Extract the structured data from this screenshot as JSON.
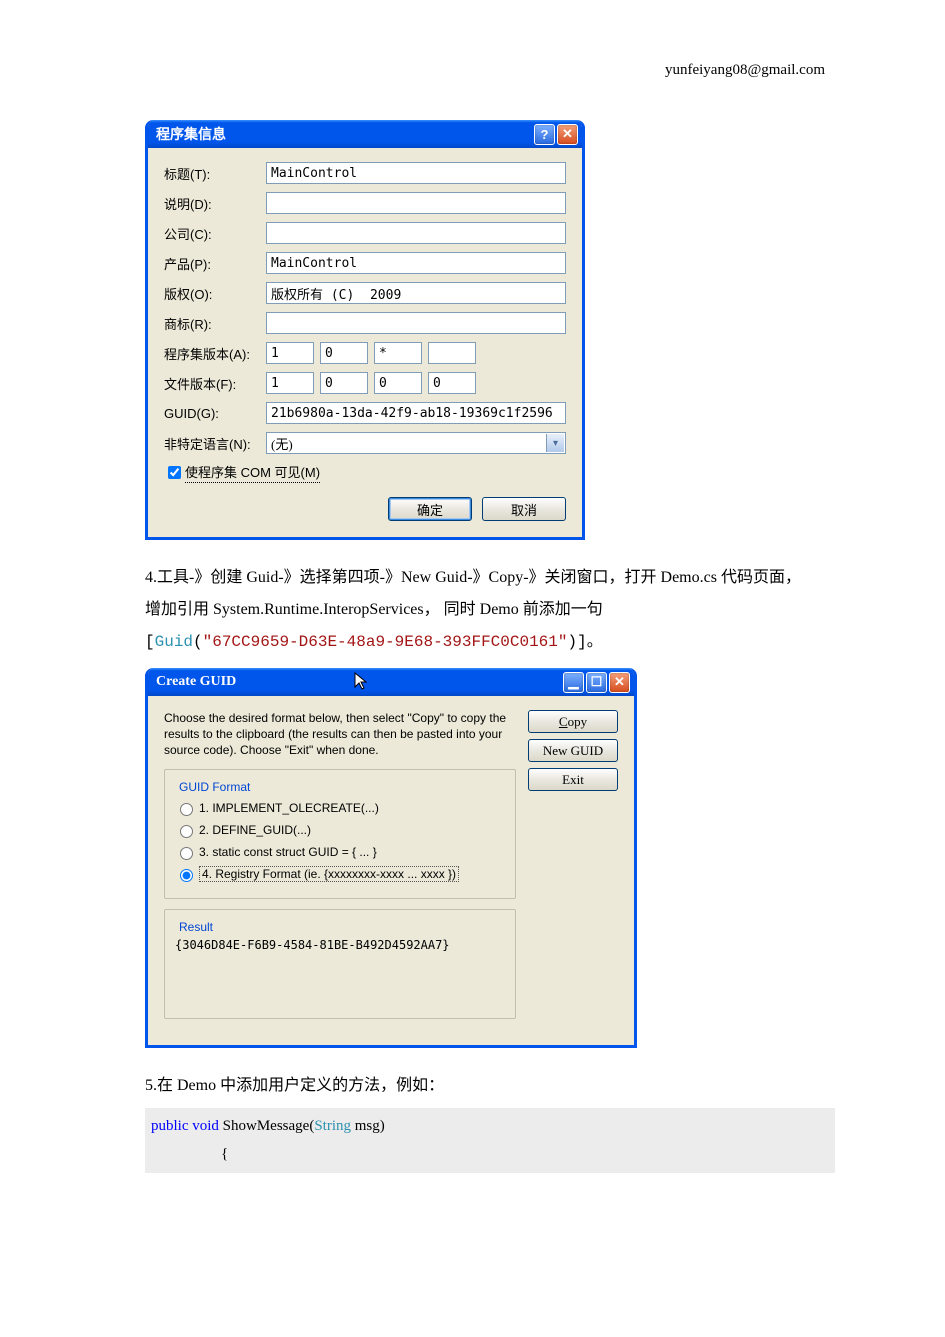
{
  "header": {
    "email": "yunfeiyang08@gmail.com"
  },
  "asm_dialog": {
    "title": "程序集信息",
    "labels": {
      "title": "标题(T):",
      "desc": "说明(D):",
      "company": "公司(C):",
      "product": "产品(P):",
      "copyright": "版权(O):",
      "trademark": "商标(R):",
      "asm_ver": "程序集版本(A):",
      "file_ver": "文件版本(F):",
      "guid": "GUID(G):",
      "lang": "非特定语言(N):"
    },
    "values": {
      "title": "MainControl",
      "desc": "",
      "company": "",
      "product": "MainControl",
      "copyright": "版权所有 (C)  2009",
      "trademark": "",
      "asm_ver": [
        "1",
        "0",
        "*",
        ""
      ],
      "file_ver": [
        "1",
        "0",
        "0",
        "0"
      ],
      "guid": "21b6980a-13da-42f9-ab18-19369c1f2596",
      "lang": "(无)"
    },
    "chk_label": "使程序集 COM 可见(M)",
    "ok": "确定",
    "cancel": "取消"
  },
  "para4_a": "4.工具-》创建 Guid-》选择第四项-》New Guid-》Copy-》关闭窗口，打开 Demo.cs 代码页面，",
  "para4_b": "增加引用 System.Runtime.InteropServices， 同时 Demo 前添加一句",
  "guid_attr": {
    "open": "[",
    "type": "Guid",
    "paren_open": "(",
    "str": "\"67CC9659-D63E-48a9-9E68-393FFC0C0161\"",
    "paren_close": ")]",
    "tail": "。"
  },
  "guid_dialog": {
    "title": "Create GUID",
    "instr": "Choose the desired format below, then select \"Copy\" to copy the results to the clipboard (the results can then be pasted into your source code).  Choose \"Exit\" when done.",
    "legend_format": "GUID Format",
    "opts": {
      "o1": "1. IMPLEMENT_OLECREATE(...)",
      "o2": "2. DEFINE_GUID(...)",
      "o3": "3. static const struct GUID = { ... }",
      "o4": "4. Registry Format (ie. {xxxxxxxx-xxxx ... xxxx })"
    },
    "legend_result": "Result",
    "result": "{3046D84E-F6B9-4584-81BE-B492D4592AA7}",
    "btn_copy": "Copy",
    "btn_new": "New GUID",
    "btn_exit": "Exit"
  },
  "para5": "5.在 Demo 中添加用户定义的方法，例如：",
  "code": {
    "kw_public": "public",
    "kw_void": "void",
    "method": " ShowMessage(",
    "type_string": "String",
    "arg_tail": " msg)",
    "brace": "{"
  }
}
